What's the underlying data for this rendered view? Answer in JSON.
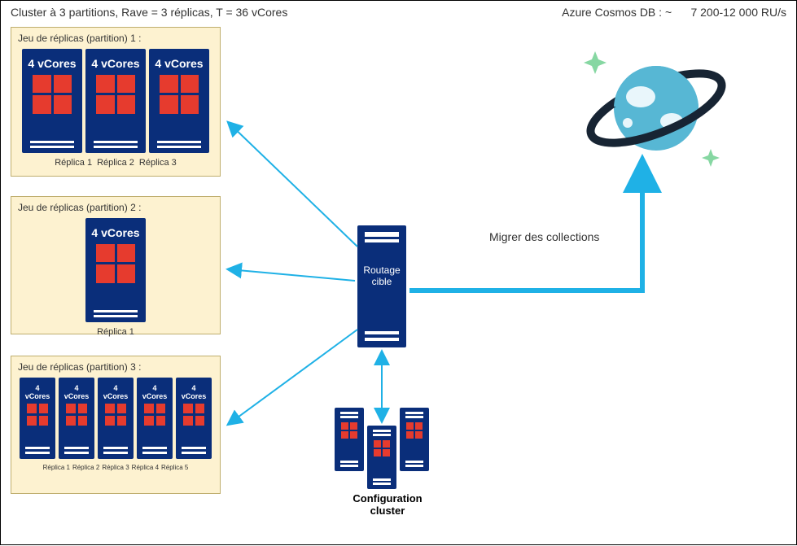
{
  "header": {
    "left": "Cluster à 3 partitions, Rave = 3 réplicas, T = 36 vCores",
    "right_prefix": "Azure Cosmos DB : ~",
    "right_value": "7 200-12 000 RU/s"
  },
  "server_core_label": "4 vCores",
  "partitions": [
    {
      "title": "Jeu de réplicas (partition) 1 :",
      "replicas": [
        "Réplica 1",
        "Réplica 2",
        "Réplica 3"
      ]
    },
    {
      "title": "Jeu de réplicas (partition) 2 :",
      "replicas": [
        "Réplica 1"
      ]
    },
    {
      "title": "Jeu de réplicas (partition) 3 :",
      "replicas": [
        "Réplica 1",
        "Réplica 2",
        "Réplica 3",
        "Réplica 4",
        "Réplica 5"
      ]
    }
  ],
  "router": {
    "line1": "Routage",
    "line2": "cible"
  },
  "config_cluster": {
    "line1": "Configuration",
    "line2": "cluster"
  },
  "migrate_label": "Migrer des collections",
  "colors": {
    "server": "#0a2e7a",
    "accent_red": "#e63b2e",
    "arrow": "#1fb1e6",
    "arrow_thick": "#1fb1e6",
    "partition_bg": "#fdf2d0",
    "planet_body": "#57b7d4",
    "planet_ring": "#172433",
    "sparkle": "#86d7a2"
  }
}
